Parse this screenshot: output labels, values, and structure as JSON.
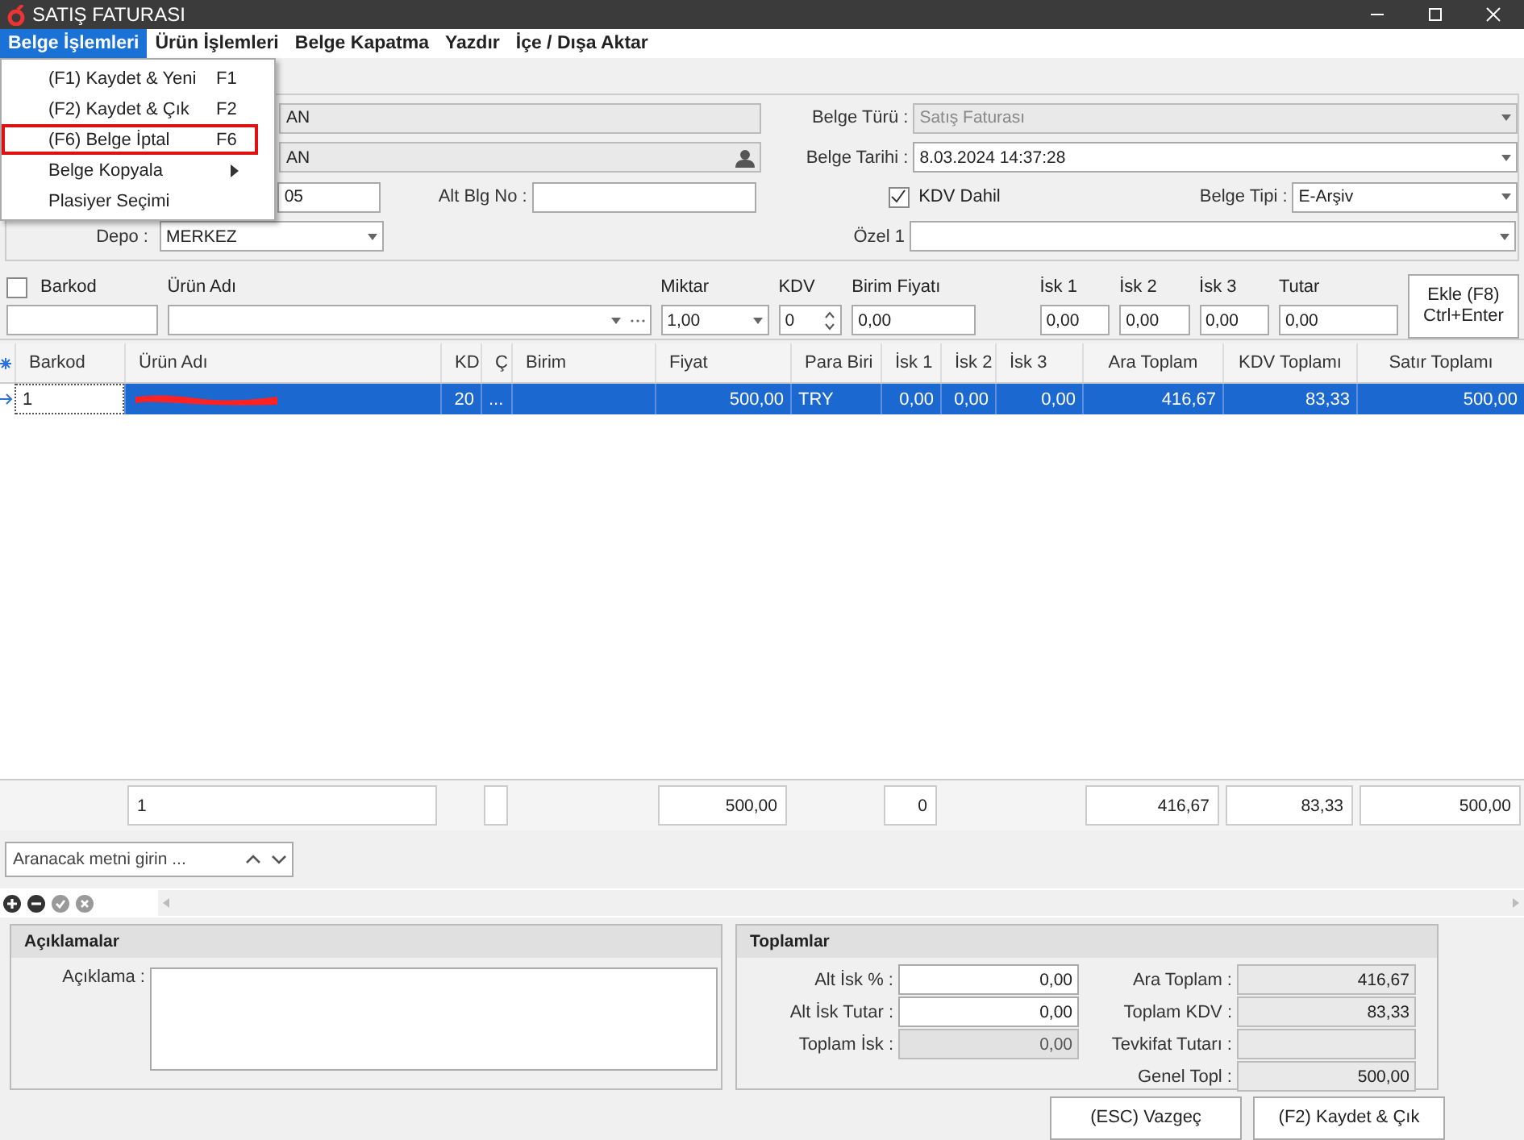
{
  "window": {
    "title": "SATIŞ FATURASI"
  },
  "menu_bar": [
    {
      "label": "Belge İşlemleri",
      "selected": true
    },
    {
      "label": "Ürün İşlemleri",
      "selected": false
    },
    {
      "label": "Belge Kapatma",
      "selected": false
    },
    {
      "label": "Yazdır",
      "selected": false
    },
    {
      "label": "İçe / Dışa Aktar",
      "selected": false
    }
  ],
  "dropdown_menu": [
    {
      "label": "(F1) Kaydet & Yeni",
      "shortcut": "F1",
      "highlighted": false,
      "submenu": false
    },
    {
      "label": "(F2) Kaydet & Çık",
      "shortcut": "F2",
      "highlighted": false,
      "submenu": false
    },
    {
      "label": "(F6) Belge İptal",
      "shortcut": "F6",
      "highlighted": true,
      "submenu": false
    },
    {
      "label": "Belge Kopyala",
      "highlighted": false,
      "submenu": true
    },
    {
      "label": "Plasiyer Seçimi",
      "highlighted": false,
      "submenu": false
    }
  ],
  "header": {
    "field_1": "AN",
    "field_2": "AN",
    "field_3": "05",
    "alt_blg_no": {
      "label": "Alt Blg No :"
    },
    "depo": {
      "label": "Depo :",
      "value": "MERKEZ"
    },
    "belge_turu": {
      "label": "Belge Türü :",
      "value": "Satış Faturası",
      "disabled": true
    },
    "belge_tarihi": {
      "label": "Belge Tarihi :",
      "value": "8.03.2024 14:37:28"
    },
    "kdv_dahil": {
      "label": "KDV Dahil",
      "checked": true
    },
    "belge_tipi": {
      "label": "Belge Tipi :",
      "value": "E-Arşiv"
    },
    "ozel_1": {
      "label": "Özel 1"
    }
  },
  "entry": {
    "barkod": {
      "label": "Barkod",
      "checked": false
    },
    "urun_adi": {
      "label": "Ürün Adı"
    },
    "miktar": {
      "label": "Miktar",
      "value": "1,00"
    },
    "kdv": {
      "label": "KDV",
      "value": "0"
    },
    "birim_fiyati": {
      "label": "Birim Fiyatı",
      "value": "0,00"
    },
    "isk_1": {
      "label": "İsk 1",
      "value": "0,00"
    },
    "isk_2": {
      "label": "İsk 2",
      "value": "0,00"
    },
    "isk_3": {
      "label": "İsk 3",
      "value": "0,00"
    },
    "tutar": {
      "label": "Tutar",
      "value": "0,00"
    },
    "add_button": "Ekle (F8)\nCtrl+Enter"
  },
  "grid": {
    "columns": [
      "Barkod",
      "Ürün Adı",
      "KD",
      "Ç",
      "Birim",
      "Fiyat",
      "Para Biri",
      "İsk 1",
      "İsk 2",
      "İsk 3",
      "Ara Toplam",
      "KDV Toplamı",
      "Satır Toplamı"
    ],
    "rows": [
      {
        "selected": true,
        "cells": [
          {
            "kind": "text",
            "text": "1"
          },
          {
            "kind": "redacted"
          },
          {
            "kind": "text",
            "text": "20"
          },
          {
            "kind": "text",
            "text": "..."
          },
          {
            "kind": "text",
            "text": ""
          },
          {
            "kind": "text",
            "text": "500,00"
          },
          {
            "kind": "text",
            "text": "TRY"
          },
          {
            "kind": "text",
            "text": "0,00"
          },
          {
            "kind": "text",
            "text": "0,00"
          },
          {
            "kind": "text",
            "text": "0,00"
          },
          {
            "kind": "text",
            "text": "416,67"
          },
          {
            "kind": "text",
            "text": "83,33"
          },
          {
            "kind": "text",
            "text": "500,00"
          }
        ]
      }
    ],
    "totals": [
      {
        "kind": "none"
      },
      {
        "kind": "box",
        "text": "1"
      },
      {
        "kind": "none"
      },
      {
        "kind": "box"
      },
      {
        "kind": "none"
      },
      {
        "kind": "box",
        "text": "500,00"
      },
      {
        "kind": "none"
      },
      {
        "kind": "box",
        "text": "0"
      },
      {
        "kind": "none"
      },
      {
        "kind": "none"
      },
      {
        "kind": "box",
        "text": "416,67"
      },
      {
        "kind": "box",
        "text": "83,33"
      },
      {
        "kind": "box",
        "text": "500,00"
      }
    ]
  },
  "search": {
    "placeholder": "Aranacak metni girin ..."
  },
  "aciklamalar": {
    "title": "Açıklamalar",
    "label": "Açıklama :"
  },
  "toplamlar": {
    "title": "Toplamlar",
    "left": [
      {
        "label": "Alt İsk % :",
        "value": "0,00",
        "disabled": false
      },
      {
        "label": "Alt İsk Tutar :",
        "value": "0,00",
        "disabled": false
      },
      {
        "label": "Toplam İsk :",
        "value": "0,00",
        "disabled": true
      }
    ],
    "right": [
      {
        "label": "Ara Toplam :",
        "value": "416,67"
      },
      {
        "label": "Toplam KDV :",
        "value": "83,33"
      },
      {
        "label": "Tevkifat Tutarı :"
      },
      {
        "label": "Genel Topl :",
        "value": "500,00"
      }
    ]
  },
  "buttons": [
    "(ESC) Vazgeç",
    "(F2) Kaydet & Çık"
  ]
}
